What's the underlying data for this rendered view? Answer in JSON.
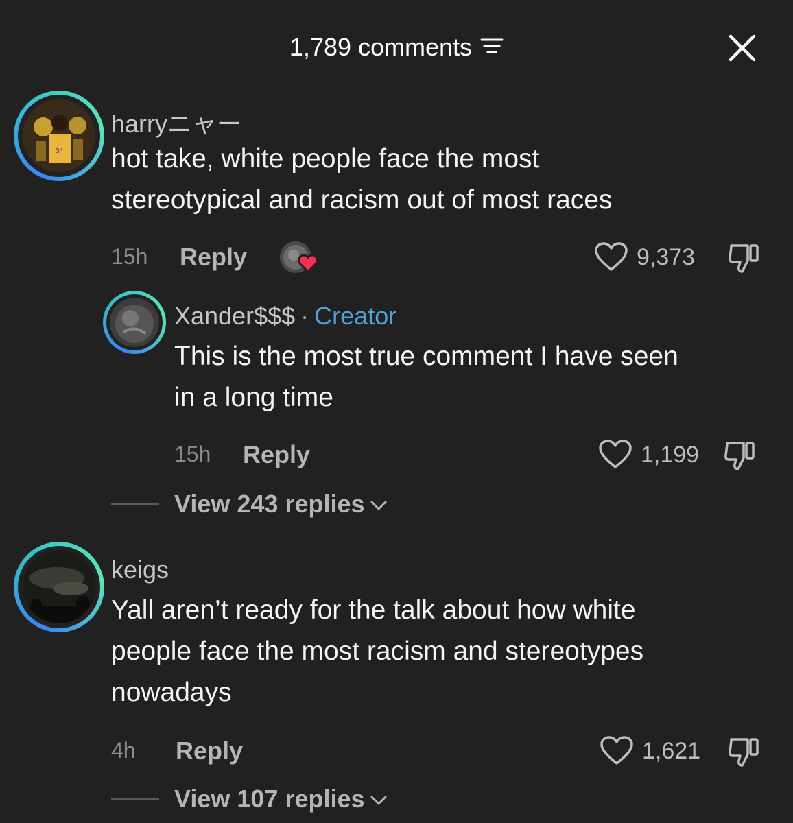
{
  "header": {
    "title": "1,789 comments",
    "filter_icon": "filter-lines-icon",
    "close_icon": "close-icon"
  },
  "comments": [
    {
      "username": "harryニャー",
      "text_lines": [
        "hot take, white people face the most",
        "stereotypical and racism out of most races"
      ],
      "time": "15h",
      "reply_label": "Reply",
      "likes": "9,373",
      "creator_liked": true,
      "replies": [
        {
          "username": "Xander$$$",
          "separator": "·",
          "badge": "Creator",
          "text_lines": [
            "This is the most true comment I have seen",
            "in a long time"
          ],
          "time": "15h",
          "reply_label": "Reply",
          "likes": "1,199"
        }
      ],
      "view_replies": "View 243 replies"
    },
    {
      "username": "keigs",
      "text_lines": [
        "Yall aren’t ready for the talk about how white",
        "people face the most racism and stereotypes",
        "nowadays"
      ],
      "time": "4h",
      "reply_label": "Reply",
      "likes": "1,621",
      "view_replies": "View 107 replies"
    }
  ],
  "colors": {
    "background": "#212121",
    "creator_badge": "#4fa3d9",
    "liked_heart": "#fe2c55"
  }
}
